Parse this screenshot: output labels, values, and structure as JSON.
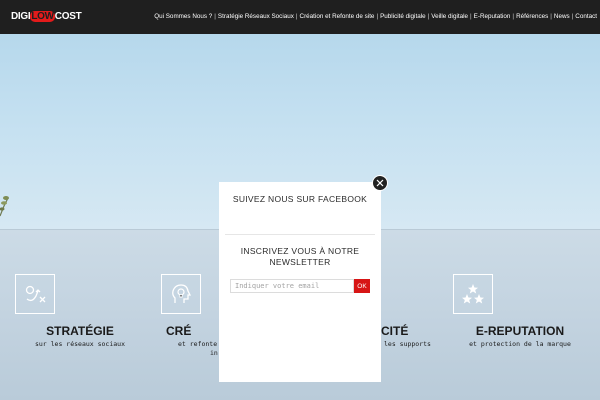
{
  "brand": {
    "logo_pre": "DIGI",
    "logo_mid": "LOW",
    "logo_post": "COST"
  },
  "nav": {
    "items": [
      "Qui Sommes Nous ?",
      "Stratégie Réseaux Sociaux",
      "Création et Refonte de site",
      "Publicité digitale",
      "Veille digitale",
      "E-Reputation",
      "Références",
      "News",
      "Contact"
    ],
    "separator": "|"
  },
  "features": [
    {
      "title": "STRATÉGIE",
      "subtitle": "sur les réseaux sociaux",
      "icon": "strategy-play-icon"
    },
    {
      "title": "CRÉ",
      "subtitle_line1": "et refonte",
      "subtitle_line2": "in",
      "icon": "lightbulb-head-icon"
    },
    {
      "title": "CITÉ",
      "subtitle": "les supports",
      "icon": "megaphone-icon"
    },
    {
      "title": "E-REPUTATION",
      "subtitle": "et protection de la marque",
      "icon": "stars-icon"
    }
  ],
  "popup": {
    "facebook_title": "SUIVEZ NOUS SUR FACEBOOK",
    "newsletter_line1": "INSCRIVEZ VOUS À NOTRE",
    "newsletter_line2": "NEWSLETTER",
    "email_placeholder": "Indiquer votre email",
    "submit_label": "OK"
  },
  "colors": {
    "topbar": "#1f1f1f",
    "accent_red": "#d71515",
    "sky": "#c6e1f1",
    "lower_bg": "#c3d3e0"
  }
}
